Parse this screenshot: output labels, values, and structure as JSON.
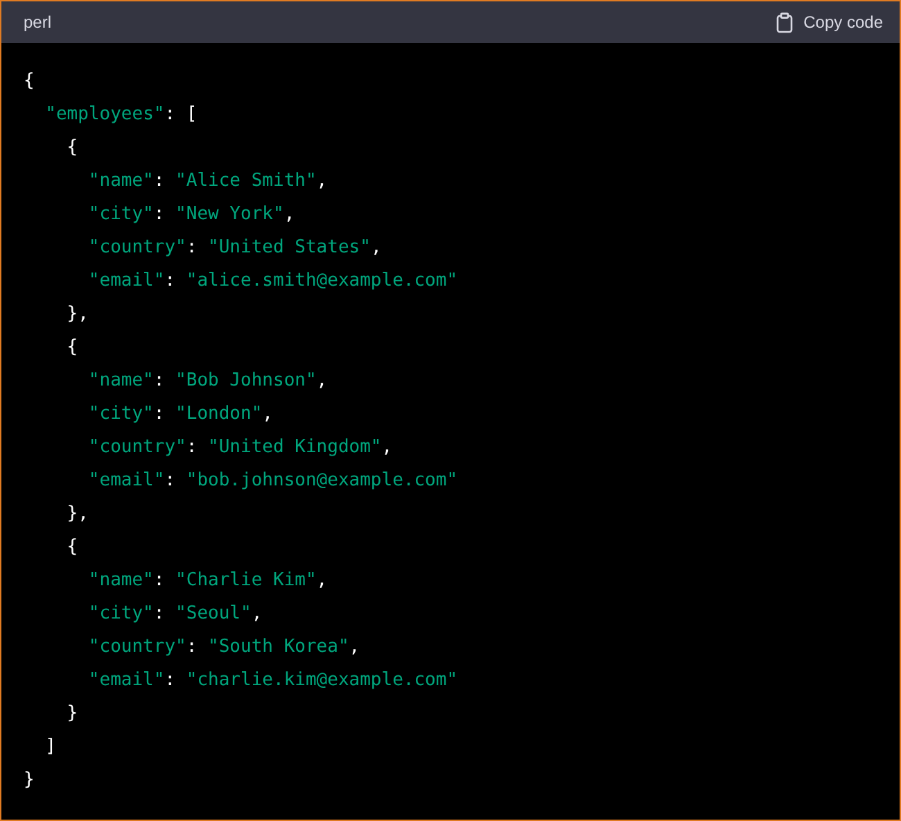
{
  "header": {
    "language": "perl",
    "copy_button": "Copy code"
  },
  "code": [
    {
      "tokens": [
        {
          "kind": "punct",
          "text": "{"
        }
      ],
      "children": [
        {
          "tokens": [
            {
              "kind": "string",
              "text": "\"employees\""
            },
            {
              "kind": "punct",
              "text": ": ["
            }
          ],
          "children": [
            {
              "tokens": [
                {
                  "kind": "punct",
                  "text": "{"
                }
              ],
              "children": [
                {
                  "tokens": [
                    {
                      "kind": "string",
                      "text": "\"name\""
                    },
                    {
                      "kind": "punct",
                      "text": ": "
                    },
                    {
                      "kind": "string",
                      "text": "\"Alice Smith\""
                    },
                    {
                      "kind": "punct",
                      "text": ","
                    }
                  ]
                },
                {
                  "tokens": [
                    {
                      "kind": "string",
                      "text": "\"city\""
                    },
                    {
                      "kind": "punct",
                      "text": ": "
                    },
                    {
                      "kind": "string",
                      "text": "\"New York\""
                    },
                    {
                      "kind": "punct",
                      "text": ","
                    }
                  ]
                },
                {
                  "tokens": [
                    {
                      "kind": "string",
                      "text": "\"country\""
                    },
                    {
                      "kind": "punct",
                      "text": ": "
                    },
                    {
                      "kind": "string",
                      "text": "\"United States\""
                    },
                    {
                      "kind": "punct",
                      "text": ","
                    }
                  ]
                },
                {
                  "tokens": [
                    {
                      "kind": "string",
                      "text": "\"email\""
                    },
                    {
                      "kind": "punct",
                      "text": ": "
                    },
                    {
                      "kind": "string",
                      "text": "\"alice.smith@example.com\""
                    }
                  ]
                }
              ],
              "close": [
                {
                  "kind": "punct",
                  "text": "},"
                }
              ]
            },
            {
              "tokens": [
                {
                  "kind": "punct",
                  "text": "{"
                }
              ],
              "children": [
                {
                  "tokens": [
                    {
                      "kind": "string",
                      "text": "\"name\""
                    },
                    {
                      "kind": "punct",
                      "text": ": "
                    },
                    {
                      "kind": "string",
                      "text": "\"Bob Johnson\""
                    },
                    {
                      "kind": "punct",
                      "text": ","
                    }
                  ]
                },
                {
                  "tokens": [
                    {
                      "kind": "string",
                      "text": "\"city\""
                    },
                    {
                      "kind": "punct",
                      "text": ": "
                    },
                    {
                      "kind": "string",
                      "text": "\"London\""
                    },
                    {
                      "kind": "punct",
                      "text": ","
                    }
                  ]
                },
                {
                  "tokens": [
                    {
                      "kind": "string",
                      "text": "\"country\""
                    },
                    {
                      "kind": "punct",
                      "text": ": "
                    },
                    {
                      "kind": "string",
                      "text": "\"United Kingdom\""
                    },
                    {
                      "kind": "punct",
                      "text": ","
                    }
                  ]
                },
                {
                  "tokens": [
                    {
                      "kind": "string",
                      "text": "\"email\""
                    },
                    {
                      "kind": "punct",
                      "text": ": "
                    },
                    {
                      "kind": "string",
                      "text": "\"bob.johnson@example.com\""
                    }
                  ]
                }
              ],
              "close": [
                {
                  "kind": "punct",
                  "text": "},"
                }
              ]
            },
            {
              "tokens": [
                {
                  "kind": "punct",
                  "text": "{"
                }
              ],
              "children": [
                {
                  "tokens": [
                    {
                      "kind": "string",
                      "text": "\"name\""
                    },
                    {
                      "kind": "punct",
                      "text": ": "
                    },
                    {
                      "kind": "string",
                      "text": "\"Charlie Kim\""
                    },
                    {
                      "kind": "punct",
                      "text": ","
                    }
                  ]
                },
                {
                  "tokens": [
                    {
                      "kind": "string",
                      "text": "\"city\""
                    },
                    {
                      "kind": "punct",
                      "text": ": "
                    },
                    {
                      "kind": "string",
                      "text": "\"Seoul\""
                    },
                    {
                      "kind": "punct",
                      "text": ","
                    }
                  ]
                },
                {
                  "tokens": [
                    {
                      "kind": "string",
                      "text": "\"country\""
                    },
                    {
                      "kind": "punct",
                      "text": ": "
                    },
                    {
                      "kind": "string",
                      "text": "\"South Korea\""
                    },
                    {
                      "kind": "punct",
                      "text": ","
                    }
                  ]
                },
                {
                  "tokens": [
                    {
                      "kind": "string",
                      "text": "\"email\""
                    },
                    {
                      "kind": "punct",
                      "text": ": "
                    },
                    {
                      "kind": "string",
                      "text": "\"charlie.kim@example.com\""
                    }
                  ]
                }
              ],
              "close": [
                {
                  "kind": "punct",
                  "text": "}"
                }
              ]
            }
          ],
          "close": [
            {
              "kind": "punct",
              "text": "]"
            }
          ]
        }
      ],
      "close": [
        {
          "kind": "punct",
          "text": "}"
        }
      ]
    }
  ]
}
